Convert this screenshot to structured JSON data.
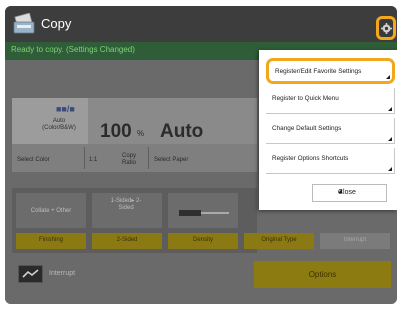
{
  "header": {
    "title": "Copy",
    "status": "Ready to copy. (Settings Changed)"
  },
  "copy_panel": {
    "color_mode_short": "Auto (Color/B&W)",
    "ratio_value": "100",
    "ratio_unit": "%",
    "paper_value": "Auto",
    "select_color_label": "Select Color",
    "ratio_preset": "1:1",
    "copy_ratio_label": "Copy Ratio",
    "select_paper_label": "Select Paper"
  },
  "function_tiles": {
    "tile1": "Collate + Other",
    "tile2": "1-Sided▸ 2-Sided",
    "tile4": "Adj. Density",
    "finishing": "Finishing",
    "two_sided": "2-Sided",
    "density": "Density",
    "original_type": "Original Type",
    "disabled_btn": "Interrupt"
  },
  "bottom": {
    "interrupt_label": "Interrupt",
    "options_label": "Options"
  },
  "menu": {
    "items": [
      {
        "label": "Register/Edit Favorite Settings"
      },
      {
        "label": "Register to Quick Menu"
      },
      {
        "label": "Change Default Settings"
      },
      {
        "label": "Register Options Shortcuts"
      }
    ],
    "close_label": "Close"
  },
  "colors": {
    "accent": "#f2a81c",
    "status_green": "#7fd07a",
    "button_yellow": "#8c7b10"
  }
}
